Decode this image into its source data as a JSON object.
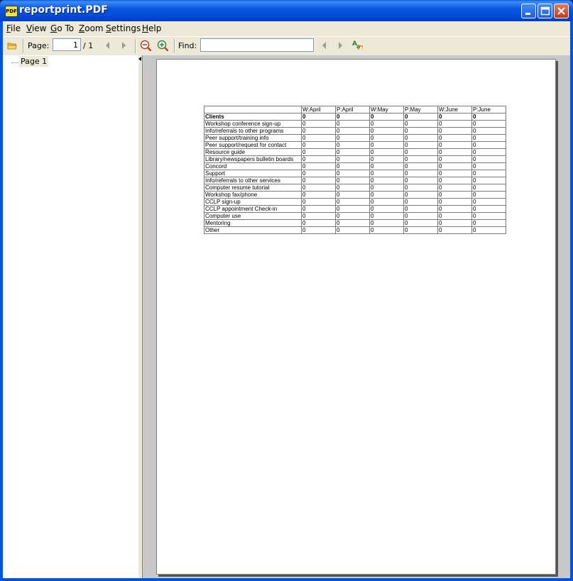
{
  "window": {
    "title": "reportprint.PDF",
    "app_icon_text": "PDF"
  },
  "menu": {
    "items": [
      {
        "key": "F",
        "rest": "ile"
      },
      {
        "key": "V",
        "rest": "iew"
      },
      {
        "key": "G",
        "rest": "o To"
      },
      {
        "key": "Z",
        "rest": "oom"
      },
      {
        "key": "S",
        "rest": "ettings"
      },
      {
        "key": "H",
        "rest": "elp"
      }
    ]
  },
  "toolbar": {
    "page_label": "Page:",
    "page_value": "1",
    "page_total": "/ 1",
    "find_label": "Find:",
    "find_value": ""
  },
  "sidebar": {
    "items": [
      {
        "label": "Page 1"
      }
    ]
  },
  "report": {
    "headers": [
      "",
      "W:April",
      "P:April",
      "W:May",
      "P:May",
      "W:June",
      "P:June"
    ],
    "rows": [
      {
        "label": "Clients",
        "bold": true,
        "values": [
          "0",
          "0",
          "0",
          "0",
          "0",
          "0"
        ]
      },
      {
        "label": "Workshop conference sign-up",
        "values": [
          "0",
          "0",
          "0",
          "0",
          "0",
          "0"
        ]
      },
      {
        "label": "Info/referrals to other programs",
        "values": [
          "0",
          "0",
          "0",
          "0",
          "0",
          "0"
        ]
      },
      {
        "label": "Peer support/training info",
        "values": [
          "0",
          "0",
          "0",
          "0",
          "0",
          "0"
        ]
      },
      {
        "label": "Peer support/request for contact",
        "values": [
          "0",
          "0",
          "0",
          "0",
          "0",
          "0"
        ]
      },
      {
        "label": "Resource guide",
        "values": [
          "0",
          "0",
          "0",
          "0",
          "0",
          "0"
        ]
      },
      {
        "label": "Library/newspapers bulletin boards",
        "values": [
          "0",
          "0",
          "0",
          "0",
          "0",
          "0"
        ]
      },
      {
        "label": "Concord",
        "values": [
          "0",
          "0",
          "0",
          "0",
          "0",
          "0"
        ]
      },
      {
        "label": "Support",
        "values": [
          "0",
          "0",
          "0",
          "0",
          "0",
          "0"
        ]
      },
      {
        "label": "Info/referrals to other services",
        "values": [
          "0",
          "0",
          "0",
          "0",
          "0",
          "0"
        ]
      },
      {
        "label": "Computer resume tutorial",
        "values": [
          "0",
          "0",
          "0",
          "0",
          "0",
          "0"
        ]
      },
      {
        "label": "Workshop fax/phone",
        "values": [
          "0",
          "0",
          "0",
          "0",
          "0",
          "0"
        ]
      },
      {
        "label": "CCLP sign-up",
        "values": [
          "0",
          "0",
          "0",
          "0",
          "0",
          "0"
        ]
      },
      {
        "label": "CCLP appointment Check-in",
        "values": [
          "0",
          "0",
          "0",
          "0",
          "0",
          "0"
        ]
      },
      {
        "label": "Computer use",
        "values": [
          "0",
          "0",
          "0",
          "0",
          "0",
          "0"
        ]
      },
      {
        "label": "Mentoring",
        "values": [
          "0",
          "0",
          "0",
          "0",
          "0",
          "0"
        ]
      },
      {
        "label": "Other",
        "values": [
          "0",
          "0",
          "0",
          "0",
          "0",
          "0"
        ]
      }
    ]
  }
}
